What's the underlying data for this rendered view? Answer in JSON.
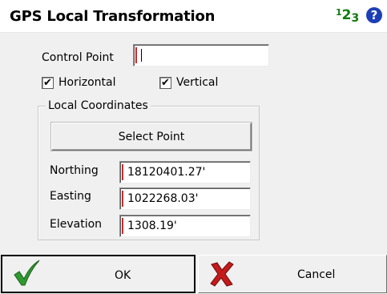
{
  "header": {
    "title": "GPS Local Transformation",
    "input_mode_super": "1",
    "input_mode_main": "2",
    "input_mode_sub": "3",
    "help_symbol": "?"
  },
  "control_point": {
    "label": "Control Point",
    "value": ""
  },
  "options": {
    "horizontal": {
      "label": "Horizontal",
      "checked": true
    },
    "vertical": {
      "label": "Vertical",
      "checked": true
    }
  },
  "local_coordinates": {
    "group_title": "Local Coordinates",
    "select_point_label": "Select Point",
    "northing": {
      "label": "Northing",
      "value": "18120401.27'"
    },
    "easting": {
      "label": "Easting",
      "value": "1022268.03'"
    },
    "elevation": {
      "label": "Elevation",
      "value": "1308.19'"
    }
  },
  "footer": {
    "ok_label": "OK",
    "cancel_label": "Cancel"
  },
  "colors": {
    "accent_red": "#e02020",
    "ok_green": "#2f9a2f",
    "cancel_red": "#c41a1a",
    "help_blue": "#1d3fb5"
  },
  "icons": {
    "ok": "check-icon",
    "cancel": "x-icon",
    "help": "help-icon",
    "input_mode": "numeric-mode-icon"
  }
}
